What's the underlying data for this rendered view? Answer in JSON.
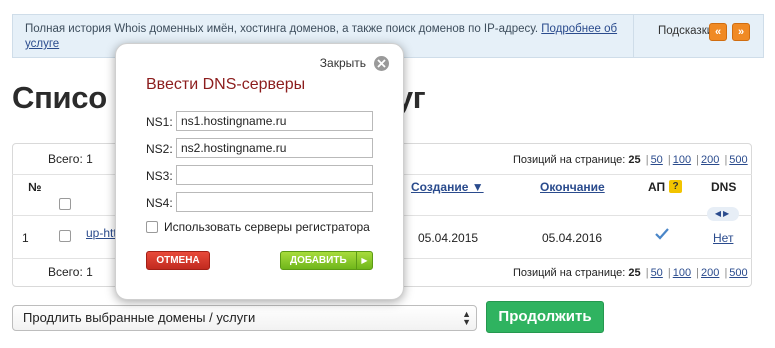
{
  "topbar": {
    "text": "Полная история Whois доменных имён, хостинга доменов, а также поиск доменов по IP-адресу.",
    "link": "Подробнее об услуге",
    "tips_label": "Подсказки",
    "prev_icon": "double-left-arrow-icon",
    "next_icon": "double-right-arrow-icon",
    "accent_color": "#f08a24"
  },
  "page": {
    "title_left": "Списо",
    "title_right": "луг"
  },
  "table": {
    "total_label": "Всего: 1",
    "per_page_label": "Позиций на странице:",
    "per_page_current": "25",
    "per_page_options": [
      "50",
      "100",
      "200",
      "500"
    ],
    "headers": {
      "num": "№",
      "created": "Создание ▼",
      "expires": "Окончание",
      "autorenew": "АП",
      "autorenew_help": "?",
      "dns": "DNS"
    },
    "rows": [
      {
        "num": "1",
        "domain": "up-htt",
        "created": "05.04.2015",
        "expires": "05.04.2016",
        "autorenew": true,
        "dns": "Нет"
      }
    ]
  },
  "bottom": {
    "action_select": "Продлить выбранные домены / услуги",
    "continue_button": "Продолжить",
    "continue_color": "#2fb360"
  },
  "modal": {
    "close_label": "Закрыть",
    "title": "Ввести DNS-серверы",
    "fields": [
      {
        "label": "NS1:",
        "value": "ns1.hostingname.ru"
      },
      {
        "label": "NS2:",
        "value": "ns2.hostingname.ru"
      },
      {
        "label": "NS3:",
        "value": ""
      },
      {
        "label": "NS4:",
        "value": ""
      }
    ],
    "use_registrar_label": "Использовать серверы регистратора",
    "use_registrar_checked": false,
    "cancel_label": "ОТМЕНА",
    "add_label": "ДОБАВИТЬ",
    "title_color": "#8c1d1d"
  }
}
